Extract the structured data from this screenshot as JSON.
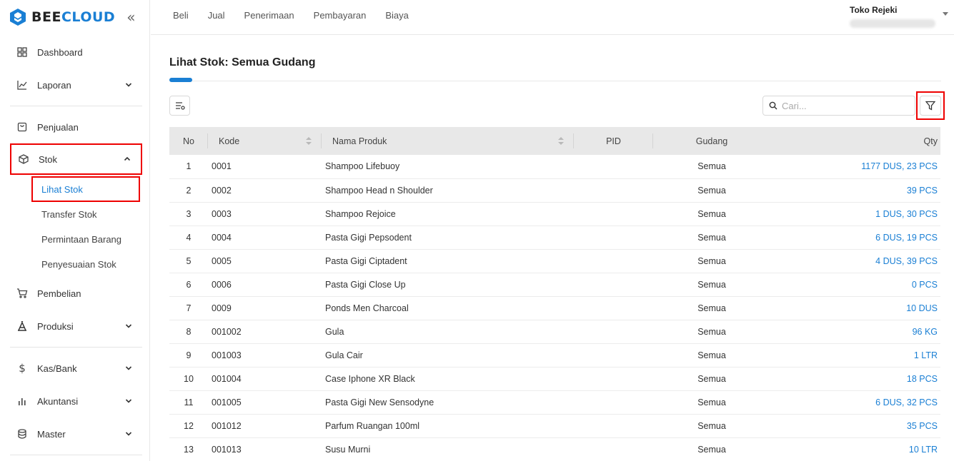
{
  "brand": {
    "bee": "BEE",
    "cloud": "CLOUD",
    "accent": "#1a7fd4"
  },
  "sidebar": {
    "items": [
      {
        "label": "Dashboard",
        "icon": "grid-icon"
      },
      {
        "label": "Laporan",
        "icon": "chart-line-icon"
      },
      {
        "label": "Penjualan",
        "icon": "shopping-bag-icon"
      },
      {
        "label": "Stok",
        "icon": "box-icon"
      },
      {
        "label": "Pembelian",
        "icon": "cart-icon"
      },
      {
        "label": "Produksi",
        "icon": "factory-icon"
      },
      {
        "label": "Kas/Bank",
        "icon": "dollar-icon"
      },
      {
        "label": "Akuntansi",
        "icon": "bar-chart-icon"
      },
      {
        "label": "Master",
        "icon": "database-icon"
      }
    ],
    "stok_sub": [
      "Lihat Stok",
      "Transfer Stok",
      "Permintaan Barang",
      "Penyesuaian Stok"
    ]
  },
  "topnav": [
    "Beli",
    "Jual",
    "Penerimaan",
    "Pembayaran",
    "Biaya"
  ],
  "account": {
    "name": "Toko Rejeki"
  },
  "page": {
    "title": "Lihat Stok: Semua Gudang"
  },
  "search": {
    "placeholder": "Cari..."
  },
  "table": {
    "headers": {
      "no": "No",
      "kode": "Kode",
      "nama": "Nama Produk",
      "pid": "PID",
      "gudang": "Gudang",
      "qty": "Qty"
    },
    "rows": [
      {
        "no": "1",
        "kode": "0001",
        "nama": "Shampoo Lifebuoy",
        "pid": "",
        "gudang": "Semua",
        "qty": "1177 DUS, 23 PCS"
      },
      {
        "no": "2",
        "kode": "0002",
        "nama": "Shampoo Head n Shoulder",
        "pid": "",
        "gudang": "Semua",
        "qty": "39 PCS"
      },
      {
        "no": "3",
        "kode": "0003",
        "nama": "Shampoo Rejoice",
        "pid": "",
        "gudang": "Semua",
        "qty": "1 DUS, 30 PCS"
      },
      {
        "no": "4",
        "kode": "0004",
        "nama": "Pasta Gigi Pepsodent",
        "pid": "",
        "gudang": "Semua",
        "qty": "6 DUS, 19 PCS"
      },
      {
        "no": "5",
        "kode": "0005",
        "nama": "Pasta Gigi Ciptadent",
        "pid": "",
        "gudang": "Semua",
        "qty": "4 DUS, 39 PCS"
      },
      {
        "no": "6",
        "kode": "0006",
        "nama": "Pasta Gigi Close Up",
        "pid": "",
        "gudang": "Semua",
        "qty": "0 PCS"
      },
      {
        "no": "7",
        "kode": "0009",
        "nama": "Ponds Men Charcoal",
        "pid": "",
        "gudang": "Semua",
        "qty": "10 DUS"
      },
      {
        "no": "8",
        "kode": "001002",
        "nama": "Gula",
        "pid": "",
        "gudang": "Semua",
        "qty": "96 KG"
      },
      {
        "no": "9",
        "kode": "001003",
        "nama": "Gula Cair",
        "pid": "",
        "gudang": "Semua",
        "qty": "1 LTR"
      },
      {
        "no": "10",
        "kode": "001004",
        "nama": "Case Iphone XR Black",
        "pid": "",
        "gudang": "Semua",
        "qty": "18 PCS"
      },
      {
        "no": "11",
        "kode": "001005",
        "nama": "Pasta Gigi New Sensodyne",
        "pid": "",
        "gudang": "Semua",
        "qty": "6 DUS, 32 PCS"
      },
      {
        "no": "12",
        "kode": "001012",
        "nama": "Parfum Ruangan 100ml",
        "pid": "",
        "gudang": "Semua",
        "qty": "35 PCS"
      },
      {
        "no": "13",
        "kode": "001013",
        "nama": "Susu Murni",
        "pid": "",
        "gudang": "Semua",
        "qty": "10 LTR"
      }
    ]
  }
}
